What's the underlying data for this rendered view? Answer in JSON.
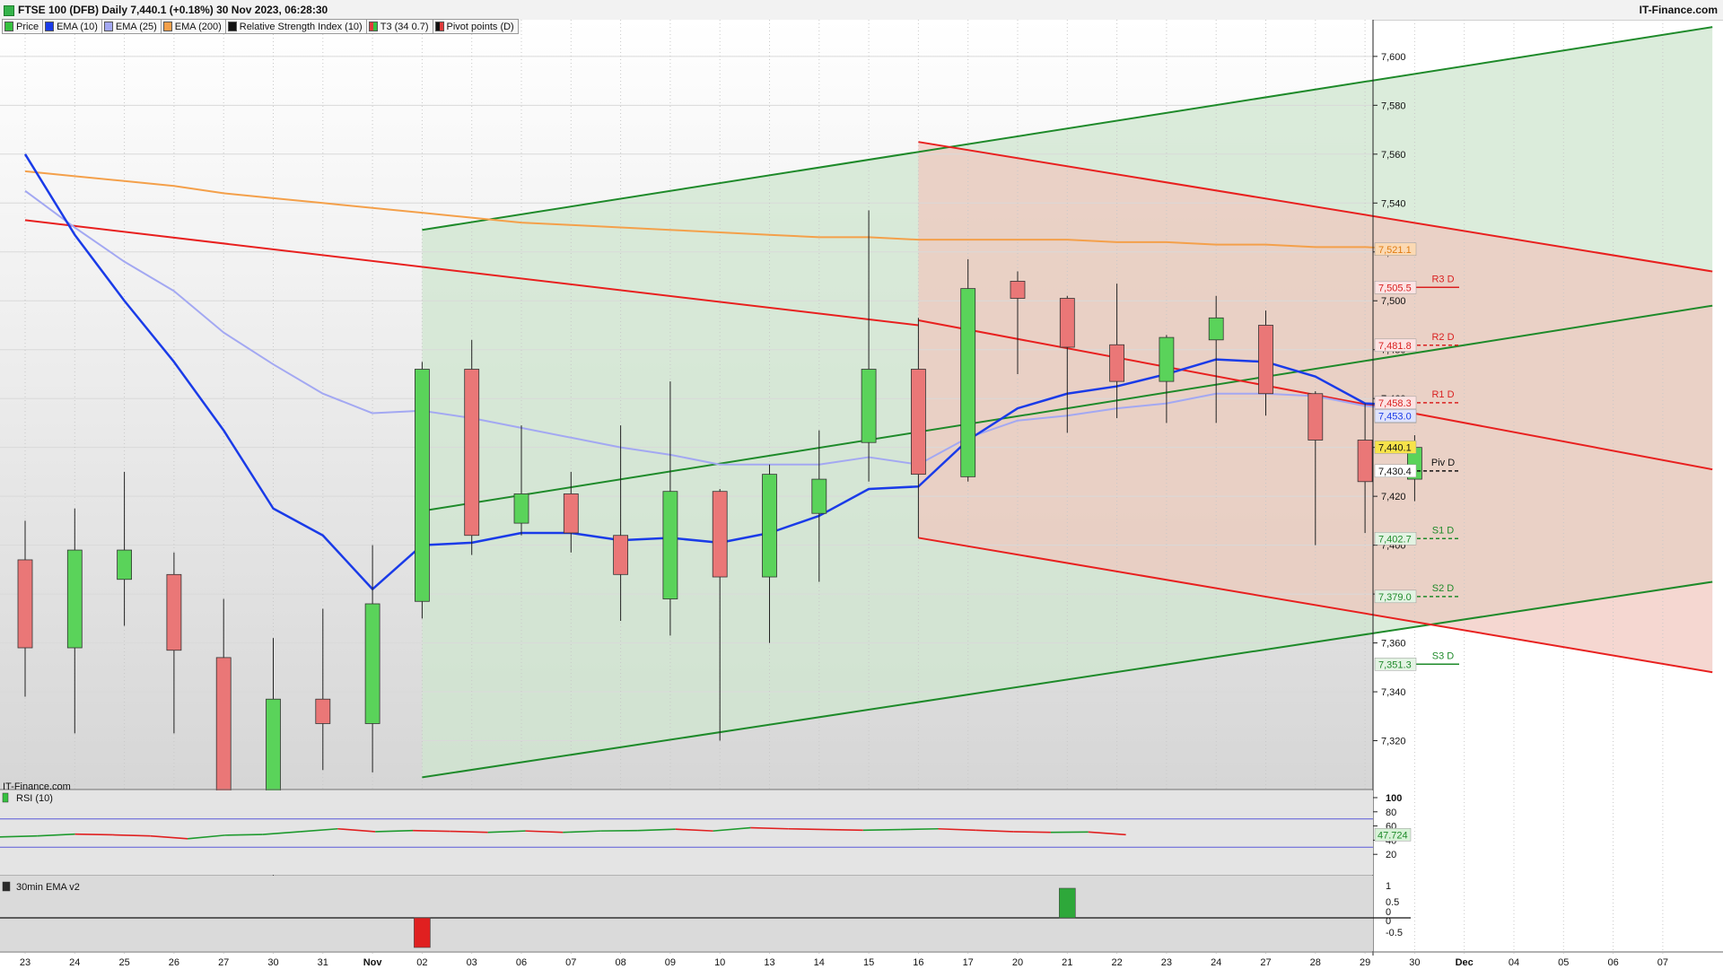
{
  "header": {
    "title": "FTSE 100 (DFB) Daily 7,440.1 (+0.18%) 30 Nov 2023, 06:28:30",
    "brand": "IT-Finance.com",
    "watermark": "IT-Finance.com"
  },
  "legend": [
    {
      "label": "Price",
      "color": "#35c13f"
    },
    {
      "label": "EMA (10)",
      "color": "#1a3be8"
    },
    {
      "label": "EMA (25)",
      "color": "#a3a8f2"
    },
    {
      "label": "EMA (200)",
      "color": "#f4a04a"
    },
    {
      "label": "Relative Strength Index (10)",
      "color": "#111111"
    },
    {
      "label": "T3 (34 0.7)",
      "color": "#e03a3a"
    },
    {
      "label": "Pivot points (D)",
      "color": "#111111"
    }
  ],
  "colors": {
    "up": "#5ad35a",
    "down": "#ea7777",
    "ema10": "#1a3be8",
    "ema25": "#a3a8f2",
    "ema200": "#f4a04a",
    "channel_green": "#1e8a2a",
    "channel_red": "#e8201f",
    "green_zone": "#dcefdc",
    "red_zone": "#f4dcd6"
  },
  "chart_data": {
    "type": "candlestick",
    "title": "FTSE 100 (DFB) Daily",
    "ylim": [
      7300,
      7615
    ],
    "yticks": [
      7320,
      7340,
      7360,
      7380,
      7400,
      7420,
      7440,
      7460,
      7480,
      7500,
      7520,
      7540,
      7560,
      7580,
      7600
    ],
    "ytick_labels": [
      "7,320",
      "7,340",
      "7,360",
      "7,380",
      "7,400",
      "7,420",
      "7,440",
      "7,460",
      "7,480",
      "7,500",
      "7,520",
      "7,540",
      "7,560",
      "7,580",
      "7,600"
    ],
    "x_labels": [
      "23",
      "24",
      "25",
      "26",
      "27",
      "30",
      "31",
      "Nov",
      "02",
      "03",
      "06",
      "07",
      "08",
      "09",
      "10",
      "13",
      "14",
      "15",
      "16",
      "17",
      "20",
      "21",
      "22",
      "23",
      "24",
      "27",
      "28",
      "29",
      "30",
      "Dec",
      "04",
      "05",
      "06",
      "07"
    ],
    "candles": [
      {
        "o": 7394,
        "h": 7410,
        "l": 7338,
        "c": 7358
      },
      {
        "o": 7358,
        "h": 7415,
        "l": 7323,
        "c": 7398
      },
      {
        "o": 7386,
        "h": 7430,
        "l": 7367,
        "c": 7398
      },
      {
        "o": 7388,
        "h": 7397,
        "l": 7323,
        "c": 7357
      },
      {
        "o": 7354,
        "h": 7378,
        "l": 7290,
        "c": 7275
      },
      {
        "o": 7275,
        "h": 7362,
        "l": 7262,
        "c": 7337
      },
      {
        "o": 7337,
        "h": 7374,
        "l": 7308,
        "c": 7327
      },
      {
        "o": 7327,
        "h": 7400,
        "l": 7307,
        "c": 7376
      },
      {
        "o": 7377,
        "h": 7475,
        "l": 7370,
        "c": 7472
      },
      {
        "o": 7472,
        "h": 7484,
        "l": 7396,
        "c": 7404
      },
      {
        "o": 7409,
        "h": 7449,
        "l": 7404,
        "c": 7421
      },
      {
        "o": 7421,
        "h": 7430,
        "l": 7397,
        "c": 7405
      },
      {
        "o": 7404,
        "h": 7449,
        "l": 7369,
        "c": 7388
      },
      {
        "o": 7378,
        "h": 7467,
        "l": 7363,
        "c": 7422
      },
      {
        "o": 7422,
        "h": 7423,
        "l": 7320,
        "c": 7387
      },
      {
        "o": 7387,
        "h": 7433,
        "l": 7360,
        "c": 7429
      },
      {
        "o": 7413,
        "h": 7447,
        "l": 7385,
        "c": 7427
      },
      {
        "o": 7442,
        "h": 7537,
        "l": 7426,
        "c": 7472
      },
      {
        "o": 7472,
        "h": 7493,
        "l": 7403,
        "c": 7429
      },
      {
        "o": 7428,
        "h": 7517,
        "l": 7426,
        "c": 7505
      },
      {
        "o": 7508,
        "h": 7512,
        "l": 7470,
        "c": 7501
      },
      {
        "o": 7501,
        "h": 7502,
        "l": 7446,
        "c": 7481
      },
      {
        "o": 7482,
        "h": 7507,
        "l": 7452,
        "c": 7467
      },
      {
        "o": 7467,
        "h": 7486,
        "l": 7450,
        "c": 7485
      },
      {
        "o": 7484,
        "h": 7502,
        "l": 7450,
        "c": 7493
      },
      {
        "o": 7490,
        "h": 7496,
        "l": 7453,
        "c": 7462
      },
      {
        "o": 7462,
        "h": 7463,
        "l": 7400,
        "c": 7443
      },
      {
        "o": 7443,
        "h": 7458,
        "l": 7405,
        "c": 7426
      },
      {
        "o": 7427,
        "h": 7445,
        "l": 7418,
        "c": 7440
      }
    ],
    "ema10": [
      7560,
      7527,
      7500,
      7475,
      7447,
      7415,
      7404,
      7382,
      7400,
      7401,
      7405,
      7405,
      7402,
      7403,
      7401,
      7405,
      7412,
      7423,
      7424,
      7443,
      7456,
      7462,
      7465,
      7470,
      7476,
      7475,
      7469,
      7458,
      7457
    ],
    "ema25": [
      7545,
      7530,
      7516,
      7504,
      7487,
      7474,
      7462,
      7454,
      7455,
      7452,
      7448,
      7444,
      7440,
      7437,
      7433,
      7433,
      7433,
      7436,
      7433,
      7444,
      7451,
      7453,
      7456,
      7458,
      7462,
      7462,
      7461,
      7457,
      7455
    ],
    "ema200": [
      7553,
      7551,
      7549,
      7547,
      7544,
      7542,
      7540,
      7538,
      7536,
      7534,
      7532,
      7531,
      7530,
      7529,
      7528,
      7527,
      7526,
      7526,
      7525,
      7525,
      7525,
      7525,
      7524,
      7524,
      7523,
      7523,
      7522,
      7522,
      7521
    ],
    "channel_green": {
      "upper": [
        [
          8,
          7529
        ],
        [
          34,
          7612
        ]
      ],
      "lower": [
        [
          8,
          7305
        ],
        [
          34,
          7385
        ]
      ],
      "mid": [
        [
          8,
          7414
        ],
        [
          34,
          7498
        ]
      ]
    },
    "channel_red": {
      "upper": [
        [
          18,
          7565
        ],
        [
          34,
          7512
        ]
      ],
      "lower": [
        [
          18,
          7403
        ],
        [
          34,
          7348
        ]
      ],
      "mid": [
        [
          18,
          7492
        ],
        [
          34,
          7431
        ]
      ]
    },
    "channel_red_prev": [
      [
        0,
        7533
      ],
      [
        18,
        7490
      ]
    ],
    "zones": [
      {
        "from": 8,
        "to": 34,
        "color": "green"
      },
      {
        "from": 18,
        "to": 34,
        "color": "red"
      }
    ],
    "pivots": [
      {
        "label": "R3 D",
        "value": 7505.5,
        "tag": "7,505.5",
        "color": "#d92020",
        "dashed": false
      },
      {
        "label": "R2 D",
        "value": 7481.8,
        "tag": "7,481.8",
        "color": "#d92020",
        "dashed": true
      },
      {
        "label": "R1 D",
        "value": 7458.3,
        "tag": "7,458.3",
        "color": "#d92020",
        "dashed": true
      },
      {
        "label": "Piv D",
        "value": 7430.4,
        "tag": "7,430.4",
        "color": "#111111",
        "dashed": true
      },
      {
        "label": "S1 D",
        "value": 7402.7,
        "tag": "7,402.7",
        "color": "#1e8a2a",
        "dashed": true
      },
      {
        "label": "S2 D",
        "value": 7379.0,
        "tag": "7,379.0",
        "color": "#1e8a2a",
        "dashed": true
      },
      {
        "label": "S3 D",
        "value": 7351.3,
        "tag": "7,351.3",
        "color": "#1e8a2a",
        "dashed": false
      }
    ],
    "price_tags": [
      {
        "value": 7521.1,
        "label": "7,521.1",
        "bg": "#fbd9b3",
        "fg": "#e07b10"
      },
      {
        "value": 7452.6,
        "label": "7,452.6",
        "bg": "#e5e6fa",
        "fg": "#5a60d6"
      },
      {
        "value": 7453.0,
        "label": "7,453.0",
        "bg": "#dfe3fb",
        "fg": "#1a3be8"
      },
      {
        "value": 7440.1,
        "label": "7,440.1",
        "bg": "#f7e34a",
        "fg": "#111111"
      }
    ],
    "rsi": {
      "label": "RSI (10)",
      "yticks": [
        20,
        40,
        60,
        80,
        100
      ],
      "upper_band": 70,
      "lower_band": 30,
      "values": [
        44.5,
        46,
        48.5,
        47.5,
        46,
        42,
        47,
        48,
        52,
        56,
        52,
        53.5,
        52.5,
        51,
        53,
        51,
        53,
        53.5,
        55.5,
        53,
        57.5,
        56,
        55,
        54,
        55,
        56,
        54,
        52,
        51,
        51.5,
        47.7
      ],
      "last_label": "47.724"
    },
    "ema30m": {
      "label": "30min EMA v2",
      "yticks": [
        "1",
        "0.5",
        "0",
        "0",
        "-0.5"
      ],
      "bars": [
        {
          "index": 8,
          "value": -1,
          "color": "red"
        },
        {
          "index": 21,
          "value": 1,
          "color": "green"
        }
      ]
    }
  }
}
